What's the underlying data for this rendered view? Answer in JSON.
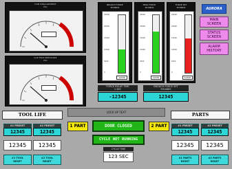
{
  "gauges": {
    "top": {
      "title": "HUB ENGAGEMENT\nPSI",
      "value_fraction": 0.45,
      "max_marker_fraction": 0.82
    },
    "bottom": {
      "title": "CAP END PRESSURE\nPSI",
      "value_fraction": 0.45,
      "max_marker_fraction": 0.82
    }
  },
  "columns": [
    {
      "title": "BROACH FORCE\nPOUNDS",
      "fill_color": "#2bd11f",
      "fill_fraction": 0.4,
      "ticks": [
        "25000",
        "20000",
        "15000",
        "10000",
        "5000",
        "0"
      ],
      "readout": "12345"
    },
    {
      "title": "PEAK FORCE\nPOUNDS",
      "fill_color": "#2bd11f",
      "fill_fraction": 0.72,
      "ticks": [
        "25000",
        "20000",
        "15000",
        "10000",
        "5000",
        "0"
      ],
      "readout": "12345"
    },
    {
      "title": "FORCE SET\nPOUNDS",
      "fill_color": "#e82020",
      "fill_fraction": 0.6,
      "ticks": [
        "25000",
        "20000",
        "15000",
        "10000",
        "5000",
        "0"
      ],
      "readout": "12345"
    }
  ],
  "force_relay": {
    "label": "FORCE RELAY TIME\n1 SEC",
    "value": "-12345"
  },
  "broach_force_set": {
    "label": "BROACH FORCE SET\nPOUNDS",
    "value": "12345"
  },
  "nav": {
    "logo": "AURORA",
    "main": "MAIN\nSCREEN",
    "status": "STATUS\nSCREEN",
    "alarm": "ALARM\nHISTORY"
  },
  "tool_life": {
    "title": "TOOL LIFE",
    "preset_labels": [
      "#1 PRESET",
      "#2 PRESET"
    ],
    "preset_values": [
      "12345",
      "12345"
    ],
    "counts": [
      "12345",
      "12345"
    ],
    "reset_labels": [
      "#1 TOOL\nRESET",
      "#2 TOOL\nRESET"
    ]
  },
  "parts": {
    "title": "PARTS",
    "preset_labels": [
      "#1 PRESET",
      "#2 PRESET"
    ],
    "preset_values": [
      "12345",
      "12345"
    ],
    "counts": [
      "12345",
      "12345"
    ],
    "reset_labels": [
      "#1 PARTS\nRESET",
      "#2 PARTS\nRESET"
    ]
  },
  "center": {
    "lock_label": "LOCK UP TEXT",
    "part1": "1 PART",
    "part2": "2 PART",
    "door": "DOOR CLOSED",
    "cycle": "CYCLE NOT RUNNING",
    "cycle_time_label": "CYCLE TIME",
    "cycle_time": "123 SEC"
  },
  "colors": {
    "background": "#a9a9a9",
    "cyan": "#2dd6d6",
    "pink": "#ee8aec",
    "green": "#22b51a",
    "red": "#e82020",
    "yellow": "#f2e60a"
  }
}
